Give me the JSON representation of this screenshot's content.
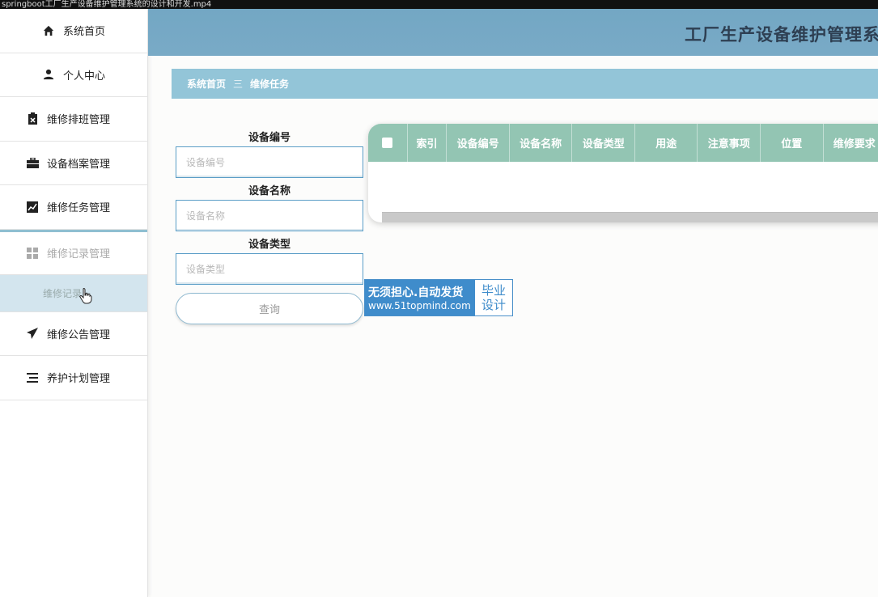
{
  "window": {
    "title": "springboot工厂生产设备维护管理系统的设计和开发.mp4"
  },
  "header": {
    "title": "工厂生产设备维护管理系"
  },
  "sidebar": {
    "items": [
      {
        "label": "系统首页",
        "icon": "home-icon"
      },
      {
        "label": "个人中心",
        "icon": "user-icon"
      },
      {
        "label": "维修排班管理",
        "icon": "clipboard-icon"
      },
      {
        "label": "设备档案管理",
        "icon": "briefcase-icon"
      },
      {
        "label": "维修任务管理",
        "icon": "chart-icon"
      },
      {
        "label": "维修记录管理",
        "icon": "grid-icon"
      },
      {
        "label": "维修公告管理",
        "icon": "paper-plane-icon"
      },
      {
        "label": "养护计划管理",
        "icon": "list-icon"
      }
    ],
    "sub_item": {
      "label": "维修记录"
    }
  },
  "breadcrumb": {
    "home": "系统首页",
    "separator": "三",
    "current": "维修任务"
  },
  "search": {
    "fields": [
      {
        "label": "设备编号",
        "placeholder": "设备编号"
      },
      {
        "label": "设备名称",
        "placeholder": "设备名称"
      },
      {
        "label": "设备类型",
        "placeholder": "设备类型"
      }
    ],
    "query_label": "查询"
  },
  "table": {
    "columns": [
      "索引",
      "设备编号",
      "设备名称",
      "设备类型",
      "用途",
      "注意事项",
      "位置",
      "维修要求"
    ]
  },
  "promo": {
    "line1": "无须担心.自动发货",
    "line2": "www.51topmind.com",
    "right1": "毕业",
    "right2": "设计"
  },
  "colors": {
    "header": "#73a7c4",
    "breadcrumb": "#93c5d8",
    "table_header": "#93c5b3",
    "promo": "#3f8ccb"
  }
}
